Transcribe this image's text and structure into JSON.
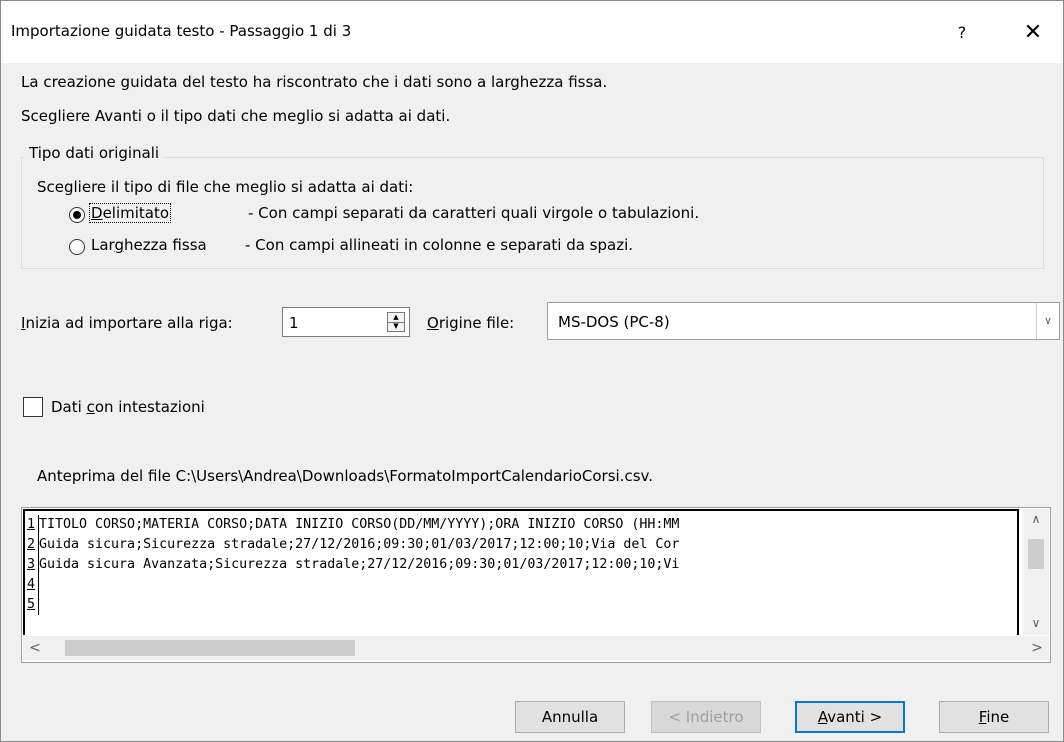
{
  "window": {
    "title": "Importazione guidata testo - Passaggio 1 di 3",
    "help": "?",
    "close": "✕"
  },
  "intro": {
    "line1": "La creazione guidata del testo ha riscontrato che i dati sono a larghezza fissa.",
    "line2": "Scegliere Avanti o il tipo dati che meglio si adatta ai dati."
  },
  "original_type": {
    "group_title": "Tipo dati originali",
    "prompt": "Scegliere il tipo di file che meglio si adatta ai dati:",
    "options": [
      {
        "pre": "",
        "accel": "D",
        "post": "elimitato",
        "description": "- Con campi separati da caratteri quali virgole o tabulazioni.",
        "selected": true
      },
      {
        "pre": "Lar",
        "accel": "g",
        "post": "hezza fissa",
        "description": "- Con campi allineati in colonne e separati da spazi.",
        "selected": false
      }
    ]
  },
  "start_row": {
    "label_accel": "I",
    "label_rest": "nizia ad importare alla riga:",
    "value": "1"
  },
  "file_origin": {
    "label_accel": "O",
    "label_rest": "rigine file:",
    "value": "MS-DOS (PC-8)"
  },
  "headers_checkbox": {
    "pre": "Dati ",
    "accel": "c",
    "post": "on intestazioni",
    "checked": false
  },
  "preview": {
    "label": "Anteprima del file C:\\Users\\Andrea\\Downloads\\FormatoImportCalendarioCorsi.csv.",
    "lines": [
      {
        "num": "1",
        "text": "TITOLO CORSO;MATERIA CORSO;DATA INIZIO CORSO(DD/MM/YYYY);ORA INIZIO CORSO (HH:MM"
      },
      {
        "num": "2",
        "text": "Guida sicura;Sicurezza stradale;27/12/2016;09:30;01/03/2017;12:00;10;Via del Cor"
      },
      {
        "num": "3",
        "text": "Guida sicura Avanzata;Sicurezza stradale;27/12/2016;09:30;01/03/2017;12:00;10;Vi"
      },
      {
        "num": "4",
        "text": ""
      },
      {
        "num": "5",
        "text": ""
      }
    ]
  },
  "buttons": {
    "cancel": "Annulla",
    "back": "< Indietro",
    "next_accel": "A",
    "next_rest": "vanti >",
    "finish_accel": "F",
    "finish_rest": "ine"
  },
  "colors": {
    "accent": "#0078d7",
    "background": "#f0f0f0"
  }
}
